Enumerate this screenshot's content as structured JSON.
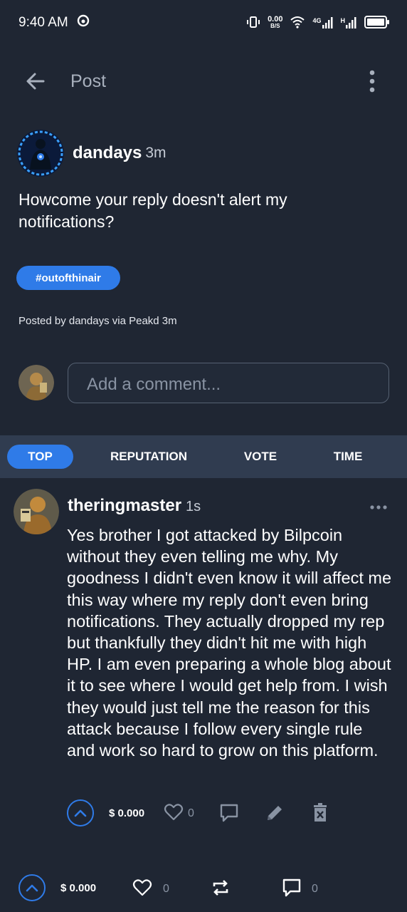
{
  "status_bar": {
    "time": "9:40 AM",
    "net_speed_value": "0.00",
    "net_speed_unit": "B/S",
    "network_4g": "4G",
    "network_h": "H"
  },
  "app_bar": {
    "title": "Post"
  },
  "post": {
    "author": "dandays",
    "time": "3m",
    "body": "Howcome your reply doesn't alert my notifications?",
    "tag": "#outofthinair",
    "posted_by": "Posted by dandays via Peakd 3m"
  },
  "comment_box": {
    "placeholder": "Add a comment..."
  },
  "sort_tabs": [
    {
      "label": "TOP",
      "active": true
    },
    {
      "label": "REPUTATION",
      "active": false
    },
    {
      "label": "VOTE",
      "active": false
    },
    {
      "label": "TIME",
      "active": false
    }
  ],
  "reply": {
    "author": "theringmaster",
    "time": "1s",
    "body": "Yes brother I got attacked by Bilpcoin without they even telling me why. My goodness I didn't even know it will affect me this way where my reply don't even bring notifications. They actually dropped my rep but thankfully they didn't hit me with high HP. I am even preparing a whole blog about it to see where I would get help from. I wish they would just tell me the reason for this attack because I follow every single rule and work so hard to grow on this platform.",
    "payout": "$ 0.000",
    "likes": "0"
  },
  "bottom_bar": {
    "payout": "$ 0.000",
    "likes": "0",
    "comments": "0"
  },
  "colors": {
    "background": "#1f2633",
    "accent": "#2f7be8",
    "sort_bar": "#303c50"
  }
}
